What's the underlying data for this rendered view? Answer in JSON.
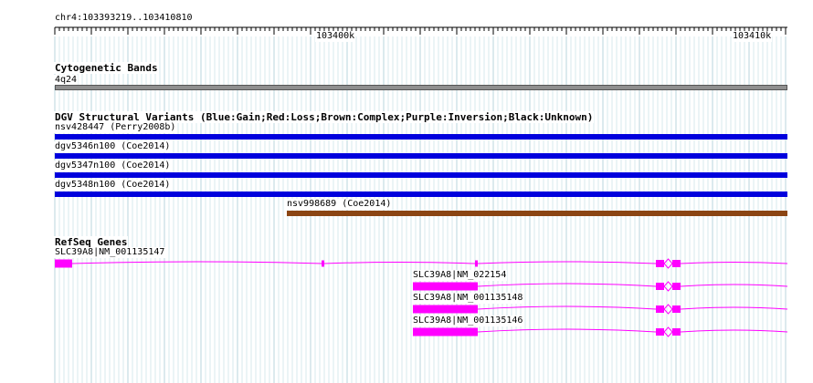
{
  "locus": "chr4:103393219..103410810",
  "ruler": {
    "tick_labels": [
      "103400k",
      "103410k"
    ]
  },
  "tracks": {
    "cytoband": {
      "title": "Cytogenetic Bands",
      "band": "4q24",
      "color": "#8f8f8f"
    },
    "dgv": {
      "title": "DGV Structural Variants (Blue:Gain;Red:Loss;Brown:Complex;Purple:Inversion;Black:Unknown)",
      "gain_color": "#0000dd",
      "complex_color": "#8b4513",
      "variants": [
        {
          "label": "nsv428447 (Perry2008b)",
          "type": "Gain"
        },
        {
          "label": "dgv5346n100 (Coe2014)",
          "type": "Gain"
        },
        {
          "label": "dgv5347n100 (Coe2014)",
          "type": "Gain"
        },
        {
          "label": "dgv5348n100 (Coe2014)",
          "type": "Gain"
        },
        {
          "label": "nsv998689 (Coe2014)",
          "type": "Complex"
        }
      ]
    },
    "refseq": {
      "title": "RefSeq Genes",
      "exon_color": "#ff00ff",
      "transcripts": [
        {
          "label": "SLC39A8|NM_001135147"
        },
        {
          "label": "SLC39A8|NM_022154"
        },
        {
          "label": "SLC39A8|NM_001135148"
        },
        {
          "label": "SLC39A8|NM_001135146"
        }
      ]
    }
  }
}
